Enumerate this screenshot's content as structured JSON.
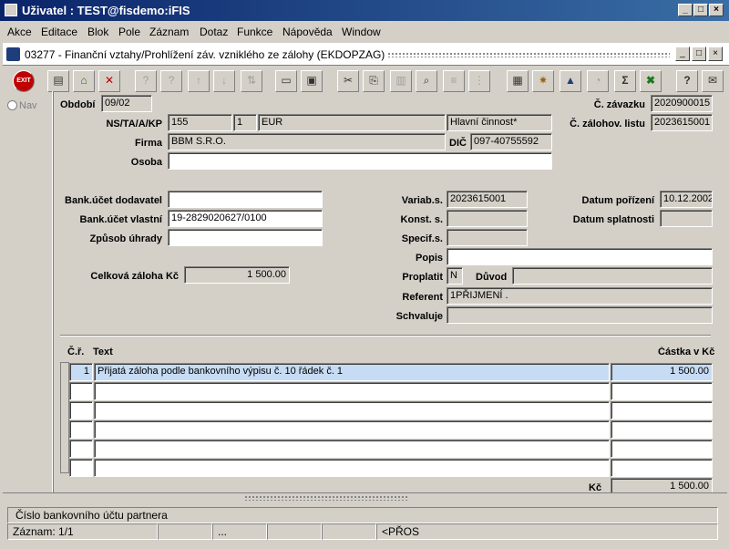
{
  "window": {
    "title": "Uživatel : TEST@fisdemo:iFIS",
    "controls": [
      "_",
      "□",
      "×"
    ]
  },
  "menu": [
    "Akce",
    "Editace",
    "Blok",
    "Pole",
    "Záznam",
    "Dotaz",
    "Funkce",
    "Nápověda",
    "Window"
  ],
  "form": {
    "title": "03277 - Finanční vztahy/Prohlížení záv. vzniklého ze zálohy (EKDOPZAG)",
    "controls": [
      "_",
      "□",
      "×"
    ]
  },
  "toolbar": {
    "exit_label": "EXIT",
    "icons": [
      "exit-icon",
      "insert-record-icon",
      "save-icon",
      "delete-record-icon",
      "query-icon",
      "query-exec-icon",
      "sort-asc-icon",
      "sort-desc-icon",
      "sort-icon",
      "print-icon",
      "print-preview-icon",
      "cut-icon",
      "copy-icon",
      "paste-icon",
      "find-icon",
      "list-icon",
      "columns-icon",
      "calculator-icon",
      "settings-icon",
      "chart-icon",
      "clock-icon",
      "sum-icon",
      "excel-icon",
      "help-icon",
      "mail-icon"
    ],
    "sum_glyph": "Σ",
    "help_glyph": "?"
  },
  "nav_label": "Nav",
  "labels": {
    "obdobi": "Období",
    "ns": "NS/TA/A/KP",
    "firma": "Firma",
    "osoba": "Osoba",
    "dic": "DIČ",
    "c_zavazku": "Č. závazku",
    "c_zalohov": "Č. zálohov. listu",
    "bank_dod": "Bank.účet dodavatel",
    "bank_vl": "Bank.účet vlastní",
    "zpusob": "Způsob úhrady",
    "celkova": "Celková záloha Kč",
    "varias": "Variab.s.",
    "konst": "Konst. s.",
    "specif": "Specif.s.",
    "popis": "Popis",
    "proplatit": "Proplatit",
    "duvod": "Důvod",
    "referent": "Referent",
    "schvaluje": "Schvaluje",
    "datum_por": "Datum pořízení",
    "datum_spl": "Datum splatnosti"
  },
  "values": {
    "obdobi": "09/02",
    "ns": "155",
    "ta": "1",
    "currency": "EUR",
    "cinnost": "Hlavní činnost*",
    "firma": "BBM S.R.O.",
    "dic": "097-40755592",
    "osoba": "",
    "c_zavazku": "2020900015",
    "c_zalohov": "2023615001",
    "bank_dod": "",
    "bank_vl": "19-2829020627/0100",
    "zpusob": "",
    "celkova": "1 500.00",
    "varias": "2023615001",
    "konst": "",
    "specif": "",
    "popis": "",
    "proplatit": "N",
    "duvod": "",
    "referent": "1PŘIJMENÍ .",
    "schvaluje": "",
    "datum_por": "10.12.2002",
    "datum_spl": ""
  },
  "grid": {
    "headers": {
      "cr": "Č.ř.",
      "text": "Text",
      "castka": "Částka v Kč"
    },
    "rows": [
      {
        "cr": "1",
        "text": "Přijatá záloha podle bankovního výpisu č. 10 řádek č. 1",
        "castka": "1 500.00"
      },
      {
        "cr": "",
        "text": "",
        "castka": ""
      },
      {
        "cr": "",
        "text": "",
        "castka": ""
      },
      {
        "cr": "",
        "text": "",
        "castka": ""
      },
      {
        "cr": "",
        "text": "",
        "castka": ""
      },
      {
        "cr": "",
        "text": "",
        "castka": ""
      }
    ],
    "total_label": "Kč",
    "total_value": "1 500.00"
  },
  "status": {
    "message": "Číslo bankovního účtu partnera",
    "record": "Záznam: 1/1",
    "ellipsis": "...",
    "mode": "<PŘOS"
  }
}
